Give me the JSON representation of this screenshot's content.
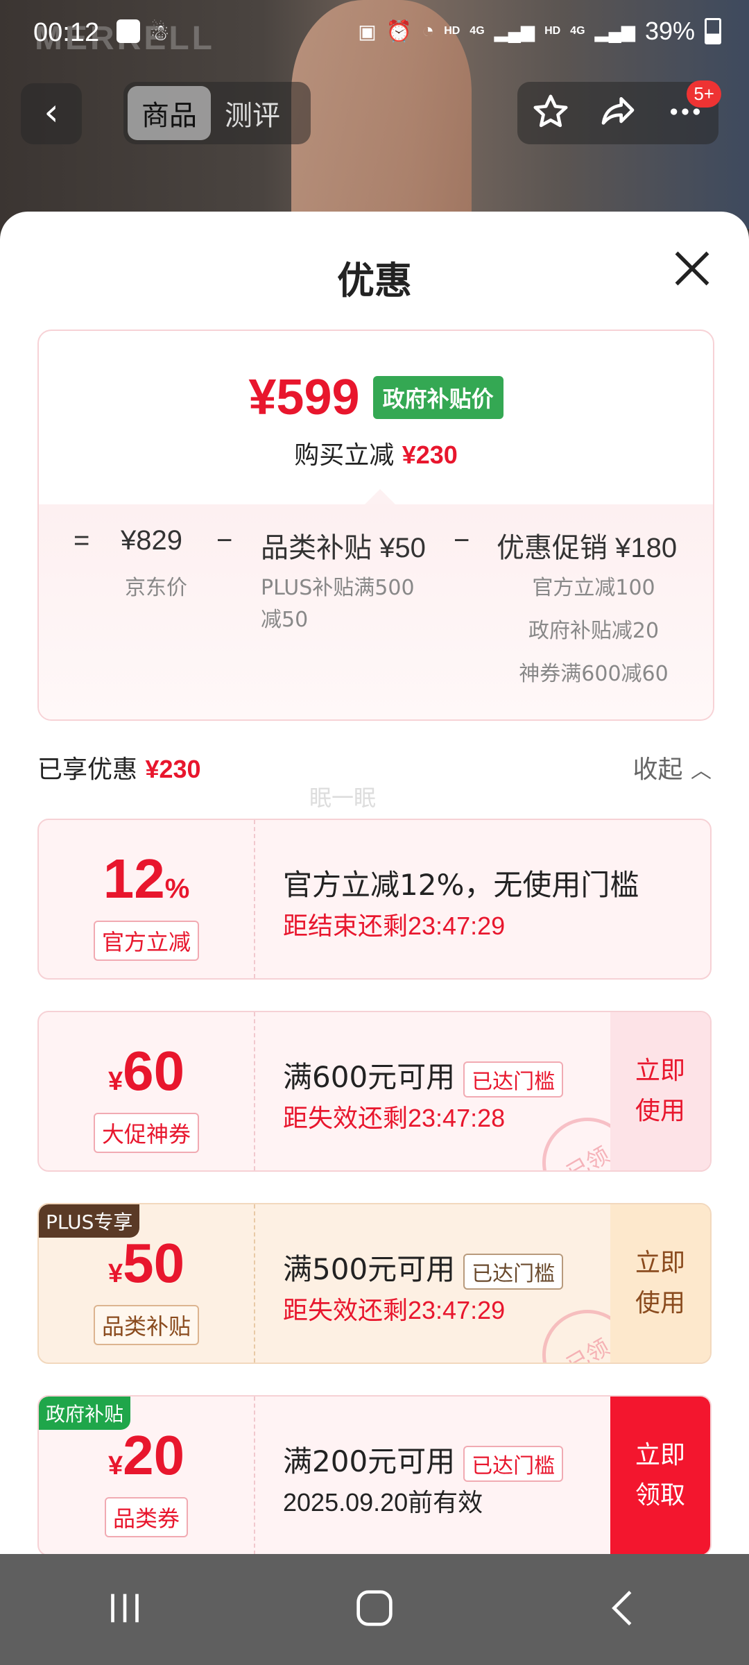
{
  "status_bar": {
    "time": "00:12",
    "hd1": "HD",
    "net1": "4G",
    "hd2": "HD",
    "net2": "4G",
    "battery": "39%"
  },
  "background": {
    "brand": "MERRELL"
  },
  "top_nav": {
    "tabs": [
      {
        "label": "商品",
        "active": true
      },
      {
        "label": "测评",
        "active": false
      }
    ],
    "badge": "5+"
  },
  "sheet": {
    "title": "优惠",
    "summary": {
      "price": "¥599",
      "price_tag": "政府补贴价",
      "reduce_label": "购买立减",
      "reduce_amount": "¥230",
      "formula": {
        "eq": "=",
        "jd_price": "¥829",
        "minus1": "−",
        "category_subsidy": "品类补贴 ¥50",
        "minus2": "−",
        "promo": "优惠促销 ¥180"
      },
      "jd_price_label": "京东价",
      "category_sub_note_1": "PLUS补贴满500",
      "category_sub_note_2": "减50",
      "promo_notes": [
        "官方立减100",
        "政府补贴减20",
        "神券满600减60"
      ]
    },
    "enjoyed_label": "已享优惠",
    "enjoyed_amount": "¥230",
    "collapse_label": "收起",
    "watermark": "眠一眠",
    "coupons": [
      {
        "amount": "12",
        "amount_suffix": "%",
        "label": "官方立减",
        "title": "官方立减12%，无使用门槛",
        "sub": "距结束还剩23:47:29"
      },
      {
        "currency": "¥",
        "amount": "60",
        "label": "大促神券",
        "title": "满600元可用",
        "tag": "已达门槛",
        "sub": "距失效还剩23:47:28",
        "action_1": "立即",
        "action_2": "使用",
        "stamp": "已领"
      },
      {
        "corner": "PLUS专享",
        "currency": "¥",
        "amount": "50",
        "label": "品类补贴",
        "title": "满500元可用",
        "tag": "已达门槛",
        "sub": "距失效还剩23:47:29",
        "action_1": "立即",
        "action_2": "使用",
        "stamp": "已领"
      },
      {
        "corner": "政府补贴",
        "currency": "¥",
        "amount": "20",
        "label": "品类券",
        "title": "满200元可用",
        "tag": "已达门槛",
        "sub": "2025.09.20前有效",
        "action_1": "立即",
        "action_2": "领取"
      }
    ]
  },
  "colors": {
    "accent_red": "#e8162d",
    "gov_green": "#34a853",
    "plus_brown": "#5a3a26"
  }
}
